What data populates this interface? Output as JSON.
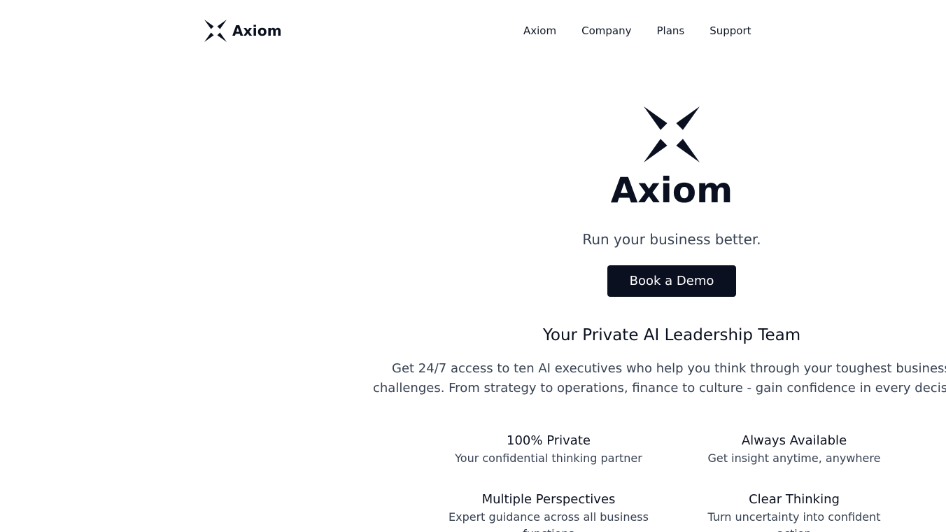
{
  "brand": {
    "name": "Axiom",
    "icon": "axiom-star-icon"
  },
  "nav": {
    "items": [
      "Axiom",
      "Company",
      "Plans",
      "Support"
    ]
  },
  "hero": {
    "title": "Axiom",
    "tagline": "Run your business better.",
    "cta_label": "Book a Demo"
  },
  "section": {
    "title": "Your Private AI Leadership Team",
    "description_line1": "Get 24/7 access to ten AI executives who help you think through your toughest business",
    "description_line2": "challenges. From strategy to operations, finance to culture - gain confidence in every decis"
  },
  "features": [
    {
      "title": "100% Private",
      "description": "Your confidential thinking partner"
    },
    {
      "title": "Always Available",
      "description": "Get insight anytime, anywhere"
    },
    {
      "title": "Multiple Perspectives",
      "description": "Expert guidance across all business functions"
    },
    {
      "title": "Clear Thinking",
      "description": "Turn uncertainty into confident action"
    }
  ],
  "colors": {
    "primary": "#0b1020",
    "text_muted": "#374151",
    "background": "#ffffff"
  }
}
